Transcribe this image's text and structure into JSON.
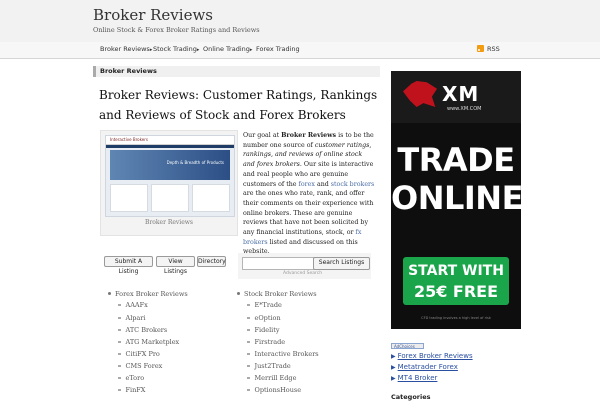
{
  "site": {
    "title": "Broker Reviews",
    "tagline": "Online Stock & Forex Broker Ratings and Reviews"
  },
  "nav": {
    "items": [
      {
        "label": "Broker Reviews",
        "has_dropdown": true
      },
      {
        "label": "Stock Trading",
        "has_dropdown": true
      },
      {
        "label": "Online Trading",
        "has_dropdown": true
      },
      {
        "label": "Forex Trading",
        "has_dropdown": false
      }
    ],
    "rss_label": "RSS"
  },
  "breadcrumb": "Broker Reviews",
  "page_heading": "Broker Reviews: Customer Ratings, Rankings and Reviews of Stock and Forex Brokers",
  "screenshot": {
    "caption": "Broker Reviews",
    "logo_text": "Interactive Brokers",
    "hero_text": "Depth & Breadth of Products"
  },
  "intro": {
    "p1": "Our goal at ",
    "brand": "Broker Reviews",
    "p2": " is to be the number one source of ",
    "emphasis": "customer ratings, rankings, and reviews of online stock and forex brokers",
    "p3": ". Our site is interactive and real people who are genuine customers of the ",
    "link_forex": "forex",
    "p4": " and ",
    "link_stock": "stock brokers",
    "p5": " are the ones who rate, rank, and offer their comments on their experience with online brokers. These are genuine reviews that have not been solicited by any financial institutions, stock, or ",
    "link_fx": "fx brokers",
    "p6": " listed and discussed on this website."
  },
  "actions": {
    "submit_label": "Submit A Listing",
    "view_label": "View Listings",
    "directory_label": "Directory"
  },
  "search": {
    "placeholder": "",
    "button_label": "Search Listings",
    "advanced_label": "Advanced Search"
  },
  "forex_list": {
    "heading": "Forex Broker Reviews",
    "items": [
      "AAAFx",
      "Alpari",
      "ATC Brokers",
      "ATG Marketplex",
      "CitiFX Pro",
      "CMS Forex",
      "eToro",
      "FinFX"
    ]
  },
  "stock_list": {
    "heading": "Stock Broker Reviews",
    "items": [
      "E*Trade",
      "eOption",
      "Fidelity",
      "Firstrade",
      "Interactive Brokers",
      "Just2Trade",
      "Merrill Edge",
      "OptionsHouse"
    ]
  },
  "ad": {
    "brand": "XM",
    "url": "www.XM.COM",
    "headline_1": "TRADE",
    "headline_2": "ONLINE",
    "cta_1": "START WITH",
    "cta_2": "25€ FREE",
    "disclaimer": "CFD trading involves a high level of risk"
  },
  "sidebar": {
    "adchoices_label": "AdChoices",
    "links": [
      "Forex Broker Reviews",
      "Metatrader Forex",
      "MT4 Broker"
    ],
    "categories_label": "Categories"
  },
  "colors": {
    "link": "#4a6da7",
    "ad_red": "#c0121d",
    "ad_green": "#1aa54a"
  }
}
